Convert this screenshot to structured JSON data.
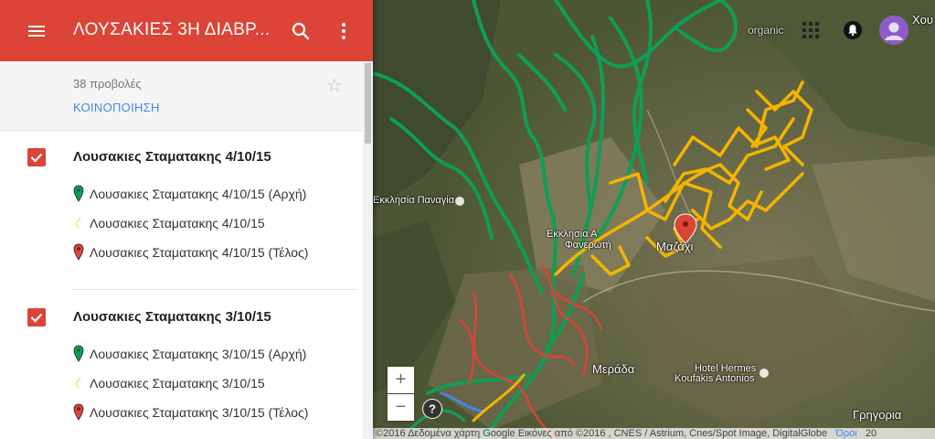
{
  "header": {
    "title": "ΛΟΥΣΑΚΙΕΣ 3Η ΔΙΑΒΡ...",
    "menu_icon": "menu-icon",
    "search_icon": "search-icon",
    "more_icon": "more-vert-icon"
  },
  "info": {
    "views": "38 προβολές",
    "share": "ΚΟΙΝΟΠΟΙΗΣΗ"
  },
  "layers": [
    {
      "title": "Λουσακιες Σταματακης 4/10/15",
      "checked": true,
      "items": [
        {
          "label": "Λουσακιες Σταματακης 4/10/15 (Αρχή)",
          "icon": "green-pin-icon"
        },
        {
          "label": "Λουσακιες Σταματακης 4/10/15",
          "icon": "track-line-icon"
        },
        {
          "label": "Λουσακιες Σταματακης 4/10/15 (Τέλος)",
          "icon": "red-pin-icon"
        }
      ]
    },
    {
      "title": "Λουσακιες Σταματακης 3/10/15",
      "checked": true,
      "items": [
        {
          "label": "Λουσακιες Σταματακης 3/10/15 (Αρχή)",
          "icon": "green-pin-icon"
        },
        {
          "label": "Λουσακιες Σταματακης 3/10/15",
          "icon": "track-line-icon"
        },
        {
          "label": "Λουσακιες Σταματακης 3/10/15 (Τέλος)",
          "icon": "red-pin-icon"
        }
      ]
    }
  ],
  "map": {
    "labels": {
      "church_panagia": "Εκκλησία Παναγία",
      "church_fan_line1": "Εκκλησία Α",
      "church_fan_line2": "Φανερωτή",
      "village": "Μαζάχι",
      "merada": "Μεράδα",
      "hotel_line1": "Hotel Hermes",
      "hotel_line2": "Koufakis Antonios",
      "grigoria": "Γρηγορια",
      "top_right": "Χου",
      "organic": "organic"
    },
    "zoom_in": "+",
    "zoom_out": "−",
    "attribution": "©2016 Δεδομένα χάρτη Google Εικόνες από ©2016 , CNES / Astrium, Cnes/Spot Image, DigitalGlobe",
    "terms": "Όροι",
    "scale": "20",
    "track_colors": {
      "green": "#0f9d58",
      "yellow": "#f4b400",
      "red": "#db4437",
      "blue": "#4285f4"
    }
  }
}
